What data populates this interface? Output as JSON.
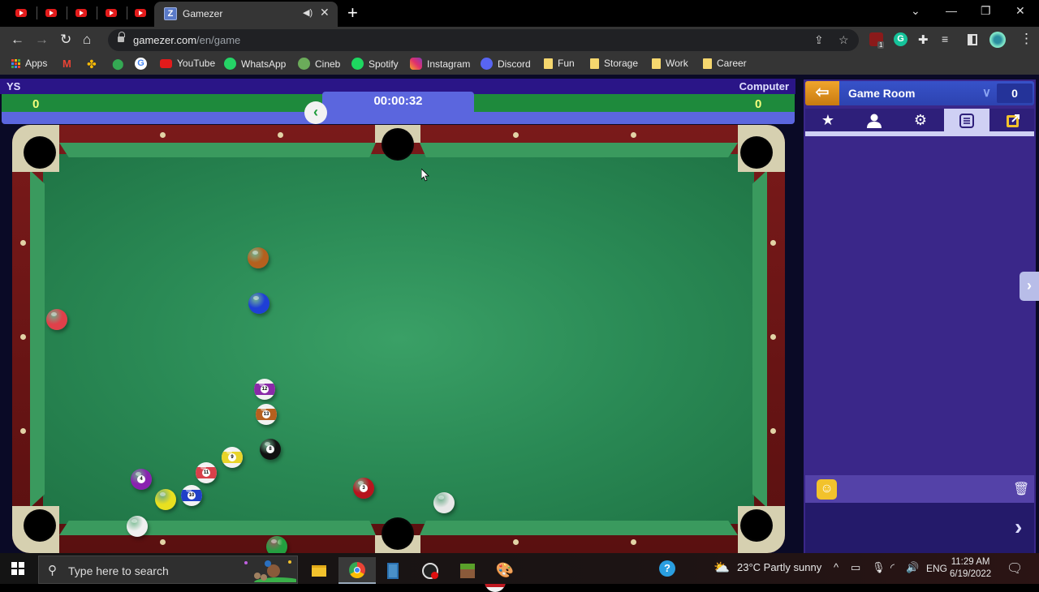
{
  "browser": {
    "background_tabs": [
      "youtube-tab",
      "youtube-tab",
      "youtube-tab",
      "youtube-tab",
      "youtube-tab"
    ],
    "active_tab": {
      "title": "Gamezer",
      "favicon": "Z"
    },
    "url_domain": "gamezer.com",
    "url_path": "/en/game",
    "bookmarks": [
      {
        "label": "Apps",
        "icon": "apps-grid-icon"
      },
      {
        "label": "",
        "icon": "gmail-icon"
      },
      {
        "label": "",
        "icon": "photos-icon"
      },
      {
        "label": "",
        "icon": "maps-icon"
      },
      {
        "label": "",
        "icon": "google-icon"
      },
      {
        "label": "YouTube",
        "icon": "youtube-icon"
      },
      {
        "label": "WhatsApp",
        "icon": "whatsapp-icon"
      },
      {
        "label": "Cineb",
        "icon": "cineb-icon"
      },
      {
        "label": "Spotify",
        "icon": "spotify-icon"
      },
      {
        "label": "Instagram",
        "icon": "instagram-icon"
      },
      {
        "label": "Discord",
        "icon": "discord-icon"
      },
      {
        "label": "Fun",
        "icon": "folder-icon"
      },
      {
        "label": "Storage",
        "icon": "folder-icon"
      },
      {
        "label": "Work",
        "icon": "folder-icon"
      },
      {
        "label": "Career",
        "icon": "folder-icon"
      }
    ],
    "extension_badge": "1"
  },
  "game": {
    "player_left": "YS",
    "player_right": "Computer",
    "score_left": "0",
    "score_right": "0",
    "timer": "00:00:32",
    "balls": [
      {
        "name": "ball-orange",
        "color": "#b5601e",
        "striped": false,
        "number": ""
      },
      {
        "name": "ball-blue",
        "color": "#1f3fd6",
        "striped": false,
        "number": ""
      },
      {
        "name": "ball-red",
        "color": "#e0404a",
        "striped": false,
        "number": ""
      },
      {
        "name": "ball-12-purple-stripe",
        "color": "#8a2aa8",
        "striped": true,
        "number": "12"
      },
      {
        "name": "ball-13-orange-stripe",
        "color": "#b5601e",
        "striped": true,
        "number": "13"
      },
      {
        "name": "ball-8-black",
        "color": "#111111",
        "striped": false,
        "number": "8"
      },
      {
        "name": "ball-9-yellow-stripe",
        "color": "#e8d42a",
        "striped": true,
        "number": "9"
      },
      {
        "name": "ball-11-red-stripe",
        "color": "#d8404a",
        "striped": true,
        "number": "11"
      },
      {
        "name": "ball-4-purple",
        "color": "#8a22b0",
        "striped": false,
        "number": "4"
      },
      {
        "name": "ball-1-yellow",
        "color": "#e8e020",
        "striped": false,
        "number": ""
      },
      {
        "name": "ball-10-blue-stripe",
        "color": "#2040c8",
        "striped": true,
        "number": "10"
      },
      {
        "name": "ball-cue",
        "color": "#f0f0f0",
        "striped": false,
        "number": ""
      },
      {
        "name": "ball-green",
        "color": "#23a040",
        "striped": false,
        "number": ""
      },
      {
        "name": "ball-3-maroon",
        "color": "#b8141e",
        "striped": false,
        "number": "3"
      },
      {
        "name": "ball-white-pocketing",
        "color": "#e8e8e8",
        "striped": false,
        "number": ""
      },
      {
        "name": "ball-15-maroon-stripe",
        "color": "#c01820",
        "striped": true,
        "number": ""
      }
    ]
  },
  "sidebar": {
    "room_title": "Game Room",
    "room_count": "0",
    "tabs": [
      {
        "name": "favorites",
        "icon": "★"
      },
      {
        "name": "players",
        "icon": "👤"
      },
      {
        "name": "settings",
        "icon": "⚙"
      },
      {
        "name": "chat",
        "icon": "☰"
      },
      {
        "name": "popout",
        "icon": "⇱"
      }
    ]
  },
  "taskbar": {
    "search_placeholder": "Type here to search",
    "weather": "23°C  Partly sunny",
    "language": "ENG",
    "time": "11:29 AM",
    "date": "6/19/2022"
  },
  "colors": {
    "felt": "#2a8a55",
    "rail": "#6e1616",
    "score_green": "#1e8a3c",
    "score_blue": "#5b66de",
    "sidebar_bg": "#3a2789",
    "accent_orange": "#f0a52c"
  }
}
